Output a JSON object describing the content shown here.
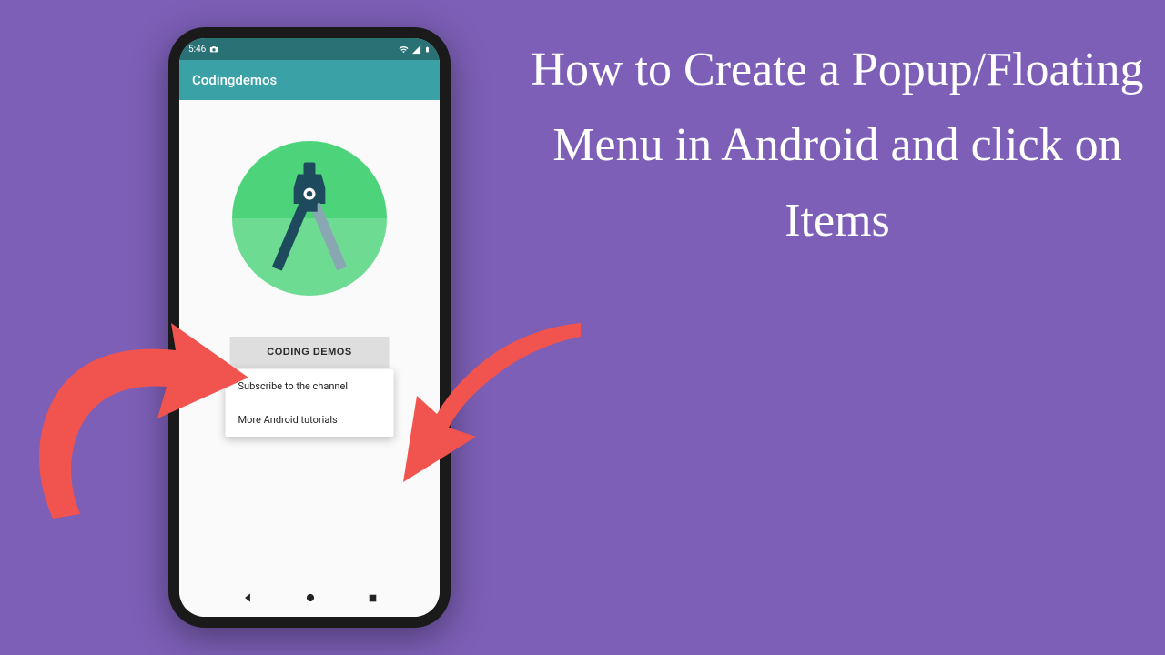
{
  "title": "How to Create a Popup/Floating Menu in Android and click on Items",
  "phone": {
    "status": {
      "time": "5:46",
      "icons": {
        "camera": "camera-icon",
        "wifi": "wifi-icon",
        "signal": "signal-icon",
        "battery": "battery-icon"
      }
    },
    "appbar": {
      "title": "Codingdemos"
    },
    "button": {
      "label": "CODING DEMOS"
    },
    "popup": {
      "items": [
        {
          "label": "Subscribe to the channel"
        },
        {
          "label": "More Android tutorials"
        }
      ]
    }
  }
}
